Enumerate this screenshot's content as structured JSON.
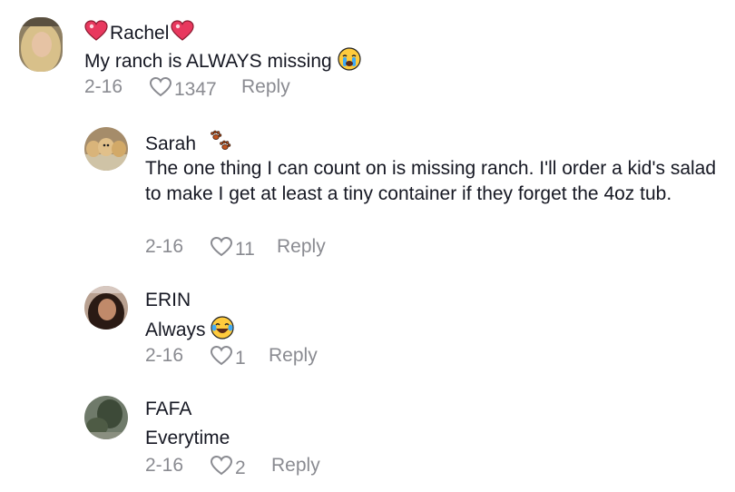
{
  "comments": [
    {
      "author": "Rachel",
      "text": "My ranch is ALWAYS missing",
      "date": "2-16",
      "likes": "1347",
      "reply_label": "Reply",
      "badge_icons": [
        "sparkling-heart-icon",
        "sparkling-heart-icon"
      ],
      "text_emoji": "loudly-crying-face-icon"
    },
    {
      "author": "Sarah",
      "text": "The one thing I can count on is missing ranch. I'll order a kid's salad to make I get at least a tiny container if they forget the 4oz tub.",
      "date": "2-16",
      "likes": "11",
      "reply_label": "Reply",
      "badge_icons": [
        "paw-prints-icon"
      ]
    },
    {
      "author": "ERIN",
      "text": "Always",
      "date": "2-16",
      "likes": "1",
      "reply_label": "Reply",
      "text_emoji": "face-with-tears-of-joy-icon"
    },
    {
      "author": "FAFA",
      "text": "Everytime",
      "date": "2-16",
      "likes": "2",
      "reply_label": "Reply"
    }
  ],
  "colors": {
    "text_primary": "#161823",
    "text_secondary": "#8a8b91",
    "background": "#ffffff"
  }
}
